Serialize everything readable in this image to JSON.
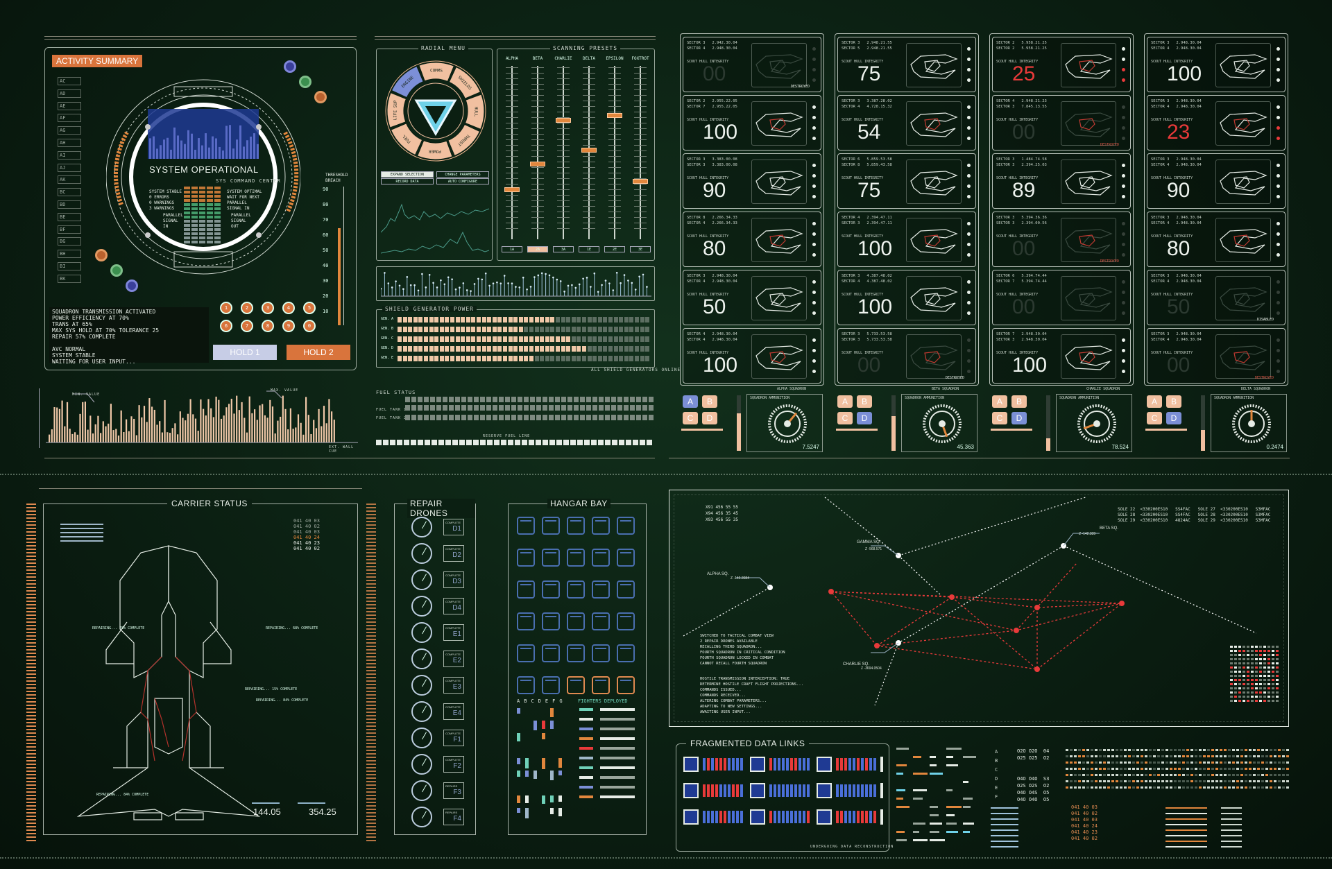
{
  "activity": {
    "title": "ACTIVITY SUMMARY",
    "status_title": "SYSTEM OPERATIONAL",
    "status_sub": "SYS COMMAND CENTER",
    "sidebar_codes": [
      "AC",
      "AD",
      "AE",
      "AF",
      "AG",
      "AH",
      "AI",
      "AJ",
      "AK",
      "BC",
      "BD",
      "BE",
      "BF",
      "BG",
      "BH",
      "BI",
      "BK"
    ],
    "log": "SQUADRON TRANSMISSION ACTIVATED\nPOWER EFFICIENCY AT 70%\nTRANS AT 65%\nMAX SYS HOLD AT 70% TOLERANCE 25\nREPAIR 57% COMPLETE\n\nAVC NORMAL\nSYSTEM STABLE\nWAITING FOR USER INPUT...",
    "threshold_label": "THRESHOLD\nBREACH",
    "scale": [
      "90",
      "80",
      "70",
      "60",
      "50",
      "40",
      "30",
      "20",
      "10"
    ],
    "keypad_top": [
      "1",
      "2",
      "3",
      "4",
      "5"
    ],
    "keypad_bottom": [
      "6",
      "7",
      "8",
      "9",
      "0"
    ],
    "hold1": "HOLD 1",
    "hold2": "HOLD 2",
    "left_panel_lines": "SYSTEM STABLE\n0 ERRORS\n0 WARNINGS\n3 WARNINGS",
    "left_panel_lines_right": "SYSTEM OPTIMAL\nWAIT FOR NEXT\nPARALLEL\nSIGNAL IN",
    "parallel_left": "PARALLEL\nSIGNAL\nIN",
    "parallel_right": "PARALLEL\nSIGNAL\nOUT"
  },
  "radial": {
    "title": "RADIAL MENU",
    "segments": [
      "COMMS",
      "SHIELDS",
      "HULL",
      "THRUST",
      "POWER",
      "FUEL",
      "LIFE SUP",
      "ENGINE"
    ],
    "buttons": [
      "EXPAND SELECTION",
      "CHANGE PARAMETERS",
      "RECORD DATA",
      "AUTO CONFIGURE"
    ]
  },
  "presets": {
    "title": "SCANNING PRESETS",
    "channels": [
      "ALPHA",
      "BETA",
      "CHARLIE",
      "DELTA",
      "EPSILON",
      "FOXTROT"
    ],
    "levels": [
      0.3,
      0.45,
      0.7,
      0.53,
      0.73,
      0.35
    ],
    "bottom": [
      "1A",
      "2A",
      "3A",
      "1E",
      "2E",
      "3E"
    ]
  },
  "shield": {
    "title": "SHIELD GENERATOR POWER",
    "rows": [
      "GEN. A",
      "GEN. B",
      "GEN. C",
      "GEN. D",
      "GEN. E"
    ],
    "fill": [
      0.62,
      0.5,
      0.68,
      0.75,
      0.55
    ],
    "footer": "ALL SHIELD GENERATORS ONLINE"
  },
  "histogram": {
    "label_left": "MIN. VALUE",
    "label_right": "MAX. VALUE",
    "footer": "EXT. WALL CUE"
  },
  "fuel": {
    "title": "FUEL STATUS",
    "tank1": "FUEL TANK 1",
    "tank2": "FUEL TANK 2",
    "reserve": "RESERVE FUEL LINE"
  },
  "squadrons": [
    {
      "name": "ALPHA SQUADRON",
      "ammo_label": "SQUADRON AMMUNITION",
      "ammo": "7.5247",
      "cards": [
        {
          "a": "SECTOR 3",
          "b": "SECTOR 4",
          "c": "2.942.30.04",
          "d": "2.948.30.04",
          "v": "00",
          "state": "dim",
          "status": "DESTROYED",
          "sw": true
        },
        {
          "a": "SECTOR 2",
          "b": "SECTOR 7",
          "c": "2.955.22.05",
          "d": "2.955.22.05",
          "v": "100",
          "state": "",
          "status": ""
        },
        {
          "a": "SECTOR 3",
          "b": "SECTOR 3",
          "c": "3.383.00.08",
          "d": "3.383.00.08",
          "v": "90",
          "state": "",
          "status": ""
        },
        {
          "a": "SECTOR 8",
          "b": "SECTOR 4",
          "c": "2.266.34.33",
          "d": "2.266.34.33",
          "v": "80",
          "state": "",
          "status": ""
        },
        {
          "a": "SECTOR 3",
          "b": "SECTOR 4",
          "c": "2.948.30.04",
          "d": "2.948.30.04",
          "v": "50",
          "state": "",
          "status": ""
        },
        {
          "a": "SECTOR 4",
          "b": "SECTOR 4",
          "c": "2.948.30.04",
          "d": "2.948.30.04",
          "v": "100",
          "state": "",
          "status": ""
        }
      ]
    },
    {
      "name": "BETA SQUADRON",
      "ammo_label": "SQUADRON AMMUNITION",
      "ammo": "45.363",
      "cards": [
        {
          "a": "SECTOR 3",
          "b": "SECTOR 5",
          "c": "2.948.21.55",
          "d": "2.948.21.55",
          "v": "75",
          "state": "",
          "status": ""
        },
        {
          "a": "SECTOR 3",
          "b": "SECTOR 4",
          "c": "3.387.28.02",
          "d": "4.728.15.32",
          "v": "54",
          "state": "",
          "status": ""
        },
        {
          "a": "SECTOR 6",
          "b": "SECTOR 8",
          "c": "5.859.53.58",
          "d": "5.859.43.58",
          "v": "75",
          "state": "",
          "status": ""
        },
        {
          "a": "SECTOR 4",
          "b": "SECTOR 3",
          "c": "2.394.47.11",
          "d": "2.394.47.11",
          "v": "100",
          "state": "",
          "status": ""
        },
        {
          "a": "SECTOR 3",
          "b": "SECTOR 4",
          "c": "4.387.48.02",
          "d": "4.387.48.02",
          "v": "100",
          "state": "",
          "status": ""
        },
        {
          "a": "SECTOR 3",
          "b": "SECTOR 3",
          "c": "5.733.53.58",
          "d": "5.733.53.58",
          "v": "00",
          "state": "dim",
          "status": "DESTROYED",
          "sw": true
        }
      ]
    },
    {
      "name": "CHARLIE SQUADRON",
      "ammo_label": "SQUADRON AMMUNITION",
      "ammo": "78.524",
      "cards": [
        {
          "a": "SECTOR 2",
          "b": "SECTOR 2",
          "c": "5.958.21.25",
          "d": "5.958.21.25",
          "v": "25",
          "state": "red",
          "status": ""
        },
        {
          "a": "SECTOR 4",
          "b": "SECTOR 3",
          "c": "2.948.21.23",
          "d": "7.845.13.55",
          "v": "00",
          "state": "dim",
          "status": "DESTROYED"
        },
        {
          "a": "SECTOR 3",
          "b": "SECTOR 3",
          "c": "1.484.74.58",
          "d": "2.394.25.03",
          "v": "89",
          "state": "",
          "status": ""
        },
        {
          "a": "SECTOR 3",
          "b": "SECTOR 3",
          "c": "5.394.36.36",
          "d": "2.394.00.56",
          "v": "00",
          "state": "dim",
          "status": "DESTROYED"
        },
        {
          "a": "SECTOR 6",
          "b": "SECTOR 7",
          "c": "5.394.74.44",
          "d": "5.394.74.44",
          "v": "00",
          "state": "dim",
          "status": ""
        },
        {
          "a": "SECTOR 7",
          "b": "SECTOR 3",
          "c": "2.948.30.04",
          "d": "2.948.30.04",
          "v": "100",
          "state": "",
          "status": ""
        }
      ]
    },
    {
      "name": "DELTA SQUADRON",
      "ammo_label": "SQUADRON AMMUNITION",
      "ammo": "0.2474",
      "cards": [
        {
          "a": "SECTOR 3",
          "b": "SECTOR 4",
          "c": "2.948.30.04",
          "d": "2.948.30.04",
          "v": "100",
          "state": "",
          "status": ""
        },
        {
          "a": "SECTOR 3",
          "b": "SECTOR 4",
          "c": "2.948.30.04",
          "d": "2.948.30.04",
          "v": "23",
          "state": "red",
          "status": ""
        },
        {
          "a": "SECTOR 3",
          "b": "SECTOR 4",
          "c": "2.948.30.04",
          "d": "2.948.30.04",
          "v": "90",
          "state": "",
          "status": ""
        },
        {
          "a": "SECTOR 3",
          "b": "SECTOR 4",
          "c": "2.948.30.04",
          "d": "2.948.30.04",
          "v": "80",
          "state": "",
          "status": ""
        },
        {
          "a": "SECTOR 3",
          "b": "SECTOR 4",
          "c": "2.948.30.04",
          "d": "2.948.30.04",
          "v": "50",
          "state": "dim",
          "status": "DISABLED",
          "sw": true
        },
        {
          "a": "SECTOR 3",
          "b": "SECTOR 4",
          "c": "2.948.30.04",
          "d": "2.948.30.04",
          "v": "00",
          "state": "dim",
          "status": "DESTROYED"
        }
      ]
    }
  ],
  "card_integrity_label": "SCOUT HULL INTEGRITY",
  "carrier": {
    "title": "CARRIER STATUS",
    "codes": [
      "041 40 03",
      "041 40 02",
      "041 40 03",
      "041 40 24",
      "041 40 23",
      "041 40 02"
    ],
    "repairs": [
      "REPAIRING... 78% COMPLETE",
      "REPAIRING... 68% COMPLETE",
      "REPAIRING... 15% COMPLETE",
      "REPAIRING... 84% COMPLETE",
      "REPAIRING... 84% COMPLETE"
    ],
    "readout1": "144.05",
    "readout2": "354.25"
  },
  "drones": {
    "title": "REPAIR DRONES",
    "ids": [
      "D1",
      "D2",
      "D3",
      "D4",
      "E1",
      "E2",
      "E3",
      "E4",
      "F1",
      "F2",
      "F3",
      "F4"
    ],
    "state": "COMPLETE",
    "state_alt": "REPAIRS"
  },
  "hangar": {
    "title": "HANGAR BAY",
    "letters": [
      "A",
      "B",
      "C",
      "D",
      "E",
      "F",
      "G"
    ],
    "deployed": "FIGHTERS DEPLOYED"
  },
  "map": {
    "labels": {
      "alpha": "ALPHA SQ.",
      "beta": "BETA SQ.",
      "gamma": "GAMMA SQ.",
      "charlie": "CHARLIE SQ.",
      "alpha_v": "Z -145.3684",
      "beta_v": "Z -142.339",
      "gamma_v": "Z -568.571",
      "charlie_v": "Z -3694.0504"
    },
    "top_left": "X91 456 55 55\nX94 456 35 45\nX93 456 55 35",
    "cols": "SOLE 22  <330200ES10   SS4FAC   SOLE 27  <330200ES10   S3MFAC\nSOLE 28  <330200ES10   SS4FAC   SOLE 28  <330200ES10   S3MFAC\nSOLE 29  <330200ES10   4824AC   SOLE 29  <330200ES10   S3MFAC",
    "log1": "SWITCHED TO TACTICAL COMBAT VIEW\n2 REPAIR DRONES AVAILABLE\nRECALLING THIRD SQUADRON...\nFOURTH SQUADRON IN CRITICAL CONDITION\nFOURTH SQUADRON LOCKED IN COMBAT\nCANNOT RECALL FOURTH SQUADRON",
    "log2": "HOSTILE TRANSMISSION INTERCEPTION: TRUE\nDETERMINE HOSTILE CRAFT FLIGHT PROJECTIONS...\nCOMMANDS ISSUED...\nCOMMANDS RECEIVED...\nALTERING COMBAT PARAMETERS...\nADAPTING TO NEW SETTINGS...\nAWAITING USER INPUT..."
  },
  "links": {
    "title": "FRAGMENTED DATA LINKS",
    "footer": "UNDERGOING DATA RECONSTRUCTION"
  },
  "br": {
    "letters": [
      "A",
      "B",
      "C",
      "D",
      "E",
      "F"
    ],
    "codes1": "O2O O2O  04\nO25 O25  O2\n\n\nO4O O4O  S3\nO2S O2S  O2\nO4O O4S  O5\nO4O O4O  O5",
    "codes2": "041 40 03\n041 40 02\n041 40 03\n041 40 24\n041 40 23\n041 40 02"
  }
}
